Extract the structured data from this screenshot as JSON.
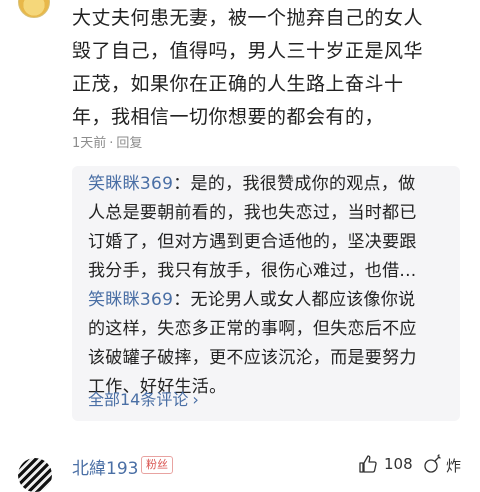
{
  "comment": {
    "lines": [
      "大丈夫何患无妻，被一个抛弃自己的女人",
      "毁了自己，值得吗，男人三十岁正是风华",
      "正茂，如果你在正确的人生路上奋斗十",
      "年，我相信一切你想要的都会有的，"
    ],
    "time": "1天前",
    "reply_label": "回复"
  },
  "replies": [
    {
      "user": "笑眯眯369",
      "lines": [
        "：是的，我很赞成你的观点，做",
        "人总是要朝前看的，我也失恋过，当时都已",
        "订婚了，但对方遇到更合适他的，坚决要跟",
        "我分手，我只有放手，很伤心难过，也借..."
      ]
    },
    {
      "user": "笑眯眯369",
      "lines": [
        "：无论男人或女人都应该像你说",
        "的这样，失恋多正常的事啊，但失恋后不应",
        "该破罐子破摔，更不应该沉沦，而是要努力",
        "工作、好好生活。"
      ]
    }
  ],
  "all_comments_label": "全部14条评论",
  "next_comment": {
    "user": "北緯193",
    "badge": "粉丝",
    "likes": "108",
    "boom_label": "炸"
  },
  "colors": {
    "link": "#4a6fa5",
    "reply_bg": "#f5f5f7",
    "badge": "#d9534f"
  }
}
